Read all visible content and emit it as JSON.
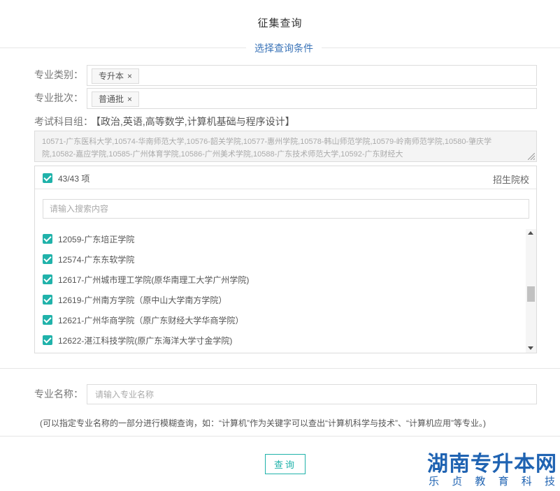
{
  "page": {
    "title": "征集查询",
    "subtitle": "选择查询条件"
  },
  "form": {
    "category": {
      "label": "专业类别：",
      "tag": "专升本",
      "remove": "×"
    },
    "batch": {
      "label": "专业批次：",
      "tag": "普通批",
      "remove": "×"
    },
    "subjects": {
      "label": "考试科目组：",
      "value": "【政治,英语,高等数学,计算机基础与程序设计】"
    },
    "schools_text": "10571-广东医科大学,10574-华南师范大学,10576-韶关学院,10577-惠州学院,10578-韩山师范学院,10579-岭南师范学院,10580-肇庆学院,10582-嘉应学院,10585-广州体育学院,10586-广州美术学院,10588-广东技术师范大学,10592-广东财经大"
  },
  "transfer": {
    "count": "43/43 项",
    "header_right": "招生院校",
    "search_placeholder": "请输入搜索内容",
    "items": [
      {
        "label": "12059-广东培正学院"
      },
      {
        "label": "12574-广东东软学院"
      },
      {
        "label": "12617-广州城市理工学院(原华南理工大学广州学院)"
      },
      {
        "label": "12619-广州南方学院（原中山大学南方学院）"
      },
      {
        "label": "12621-广州华商学院（原广东财经大学华商学院）"
      },
      {
        "label": "12622-湛江科技学院(原广东海洋大学寸金学院)"
      }
    ]
  },
  "major_name": {
    "label": "专业名称：",
    "placeholder": "请输入专业名称",
    "hint": "(可以指定专业名称的一部分进行模糊查询，如：“计算机”作为关键字可以查出“计算机科学与技术”、“计算机应用”等专业。)"
  },
  "query_button": "查询",
  "watermark": {
    "main": "湖南专升本网",
    "sub": [
      "乐",
      "贞",
      "教",
      "育",
      "科",
      "技"
    ]
  },
  "colors": {
    "accent": "#20b2aa",
    "link": "#3b74b8",
    "watermark": "#1f63b2"
  }
}
